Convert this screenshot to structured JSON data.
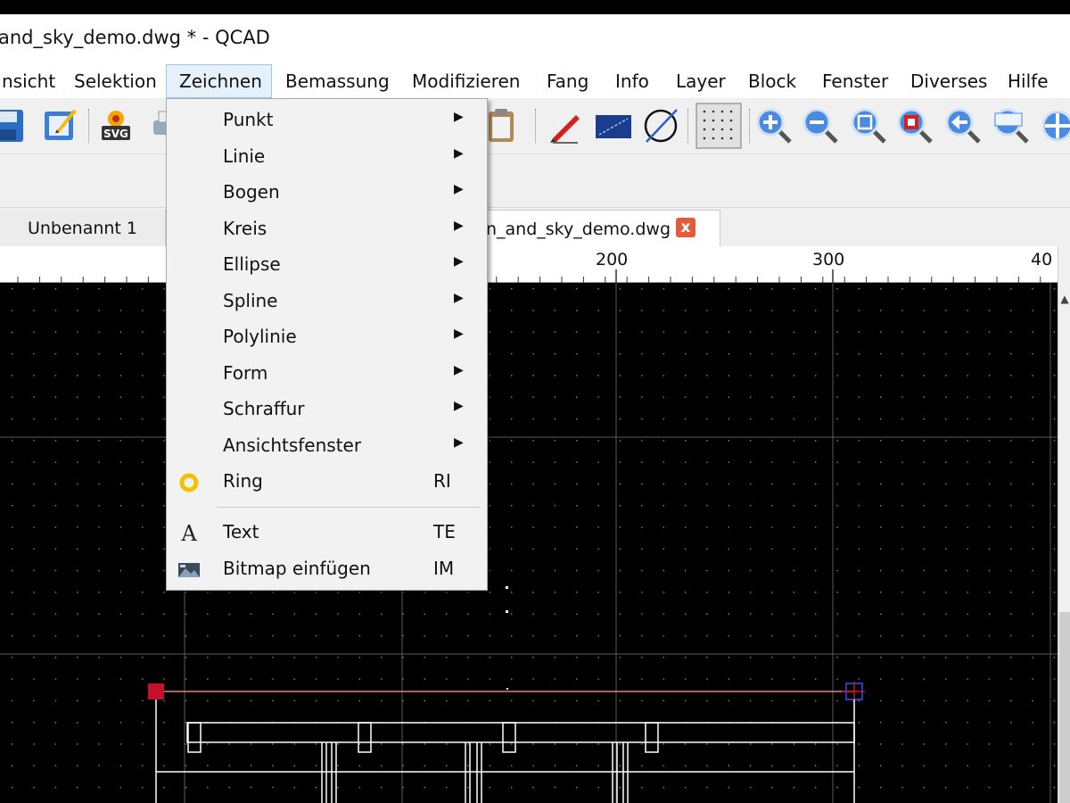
{
  "window": {
    "title": "and_sky_demo.dwg * - QCAD"
  },
  "menubar": {
    "items": [
      {
        "label": "nsicht"
      },
      {
        "label": "Selektion"
      },
      {
        "label": "Zeichnen"
      },
      {
        "label": "Bemassung"
      },
      {
        "label": "Modifizieren"
      },
      {
        "label": "Fang"
      },
      {
        "label": "Info"
      },
      {
        "label": "Layer"
      },
      {
        "label": "Block"
      },
      {
        "label": "Fenster"
      },
      {
        "label": "Diverses"
      },
      {
        "label": "Hilfe"
      }
    ]
  },
  "toolbar": {
    "icons": [
      "save-icon",
      "edit-icon",
      "svg-export-icon",
      "print-icon",
      "clipboard-icon",
      "pencil-icon",
      "draft-icon",
      "circle-slash-icon",
      "grid-icon",
      "zoom-in-icon",
      "zoom-out-icon",
      "zoom-auto-icon",
      "zoom-window-icon",
      "zoom-previous-icon",
      "zoom-selection-icon",
      "pan-icon"
    ],
    "svg_label": "SVG"
  },
  "tabs": [
    {
      "label": "Unbenannt 1"
    },
    {
      "label": "n_and_sky_demo.dwg",
      "close": "x"
    }
  ],
  "ruler": {
    "labels": [
      "200",
      "300",
      "40"
    ]
  },
  "zeichnen_menu": {
    "items": [
      {
        "label": "Punkt",
        "submenu": true
      },
      {
        "label": "Linie",
        "submenu": true
      },
      {
        "label": "Bogen",
        "submenu": true
      },
      {
        "label": "Kreis",
        "submenu": true
      },
      {
        "label": "Ellipse",
        "submenu": true
      },
      {
        "label": "Spline",
        "submenu": true
      },
      {
        "label": "Polylinie",
        "submenu": true
      },
      {
        "label": "Form",
        "submenu": true
      },
      {
        "label": "Schraffur",
        "submenu": true
      },
      {
        "label": "Ansichtsfenster",
        "submenu": true
      },
      {
        "label": "Ring",
        "shortcut": "RI",
        "icon": "ring-icon"
      },
      {
        "label": "Text",
        "shortcut": "TE",
        "icon": "text-icon",
        "icon_glyph": "A"
      },
      {
        "label": "Bitmap einfügen",
        "shortcut": "IM",
        "icon": "bitmap-icon"
      }
    ],
    "arrow_glyph": "▶"
  },
  "colors": {
    "menu_highlight": "#e5f1fb",
    "menu_highlight_border": "#99c9ef",
    "canvas_bg": "#000000",
    "entity": "#ffffff",
    "selected_line": "#e08080",
    "grip_red": "#c8102e",
    "grip_blue": "#2040c0",
    "ring_icon": "#f2c200",
    "tab_close": "#e05c3a"
  }
}
